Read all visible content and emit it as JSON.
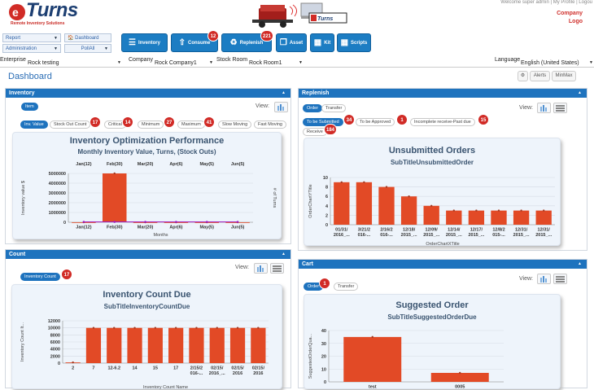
{
  "brand": {
    "name": "Turns",
    "tagline": "Remote Inventory Solutions",
    "banner_text": "Turns"
  },
  "toplinks": "Welcome super admin | My Profile | Logou",
  "company_logo": [
    "Company",
    "Logo"
  ],
  "nav": {
    "report": "Report",
    "dashboard": "Dashboard",
    "administration": "Administration",
    "pollall": "PollAll"
  },
  "toolbar": [
    {
      "label": "Inventory",
      "icon": "list-icon"
    },
    {
      "label": "Consume",
      "icon": "upload-icon",
      "badge": "12"
    },
    {
      "label": "Replenish",
      "icon": "recycle-icon",
      "badge": "221"
    },
    {
      "label": "Asset",
      "icon": "box-icon"
    },
    {
      "label": "Kit",
      "icon": "kit-icon"
    },
    {
      "label": "Scripts",
      "icon": "scripts-icon"
    }
  ],
  "filters": {
    "enterprise_label": "Enterprise",
    "enterprise": "Rock testing",
    "company_label": "Company",
    "company": "Rock Company1",
    "stockroom_label": "Stock Room",
    "stockroom": "Rock Room1",
    "language_label": "Language",
    "language": "English (United States)"
  },
  "dashboard": {
    "title": "Dashboard",
    "alerts": "Alerts",
    "minmax": "MinMax"
  },
  "inventory": {
    "title": "Inventory",
    "item": "Item",
    "view": "View:",
    "tabs": [
      {
        "label": "Inv. Value"
      },
      {
        "label": "Stock Out Count",
        "badge": "17"
      },
      {
        "label": "Critical",
        "badge": "14"
      },
      {
        "label": "Minimum",
        "badge": "27"
      },
      {
        "label": "Maximum",
        "badge": "41"
      },
      {
        "label": "Slow Moving"
      },
      {
        "label": "Fast Moving"
      }
    ]
  },
  "replenish": {
    "title": "Replenish",
    "view": "View:",
    "order": "Order",
    "transfer": "Transfer",
    "tabs": [
      {
        "label": "To be Submitted",
        "badge": "34"
      },
      {
        "label": "To be Approved",
        "badge": "1"
      },
      {
        "label": "Incomplete receive-Past due",
        "badge": "15"
      },
      {
        "label": "Receive",
        "badge": "184"
      }
    ]
  },
  "count": {
    "title": "Count",
    "view": "View:",
    "tab": "Inventory Count",
    "badge": "17"
  },
  "cart": {
    "title": "Cart",
    "view": "View:",
    "order": "Order",
    "badge": "1",
    "transfer": "Transfer"
  },
  "chart_data": [
    {
      "type": "bar",
      "title": "Inventory Optimization Performance",
      "subtitle": "Monthly Inventory Value, Turns, (Stock Outs)",
      "categories": [
        "Jan(12)",
        "Feb(30)",
        "Mar(20)",
        "Apr(6)",
        "May(5)",
        "Jun(5)"
      ],
      "values": [
        0,
        5000000,
        0,
        0,
        0,
        0
      ],
      "ylim": [
        0,
        5000000
      ],
      "yticks": [
        "5000000",
        "4000000",
        "3000000",
        "2000000",
        "1000000",
        "0"
      ],
      "ylabel": "Inventory value $",
      "y2label": "# of Turns",
      "xlabel": "Months",
      "colors": {
        "bar": "#e24a26",
        "line": "#a020c0"
      }
    },
    {
      "type": "bar",
      "title": "Unsubmitted Orders",
      "subtitle": "SubTitleUnsubmittedOrder",
      "categories": [
        "01/31/ 2016_...",
        "3/21/2 016-...",
        "2/16/2 016-...",
        "12/18/ 2015_...",
        "12/09/ 2015_...",
        "12/14/ 2015_...",
        "12/17/ 2015_...",
        "12/8/2 015-...",
        "12/31/ 2015_...",
        "12/31/ 2015_..."
      ],
      "values": [
        9,
        9,
        8,
        6,
        4,
        3,
        3,
        3,
        3,
        3
      ],
      "ylim": [
        0,
        10
      ],
      "yticks": [
        "10",
        "8",
        "6",
        "4",
        "2",
        "0"
      ],
      "ylabel": "OrderChartYTitle",
      "xlabel": "OrderChartXTitle"
    },
    {
      "type": "bar",
      "title": "Inventory Count Due",
      "subtitle": "SubTitleInventoryCountDue",
      "categories": [
        "2",
        "7",
        "12-6.2",
        "14",
        "15",
        "17",
        "2/15/2 016-...",
        "02/15/ 2016_...",
        "02/15/ 2016",
        "02/15/ 2016"
      ],
      "values": [
        200,
        10000,
        10000,
        10000,
        10000,
        10000,
        10000,
        10000,
        10000,
        10000
      ],
      "ylim": [
        0,
        12000
      ],
      "yticks": [
        "12000",
        "10000",
        "8000",
        "6000",
        "4000",
        "2000",
        "0"
      ],
      "ylabel": "Inventory Count It...",
      "xlabel": "Inventory Count Name"
    },
    {
      "type": "bar",
      "title": "Suggested Order",
      "subtitle": "SubTitleSuggestedOrderDue",
      "categories": [
        "test flow",
        "0005 way"
      ],
      "values": [
        35,
        7
      ],
      "ylim": [
        0,
        40
      ],
      "yticks": [
        "40",
        "30",
        "20",
        "10",
        "0"
      ],
      "ylabel": "SuggestedOrderQua..."
    }
  ]
}
